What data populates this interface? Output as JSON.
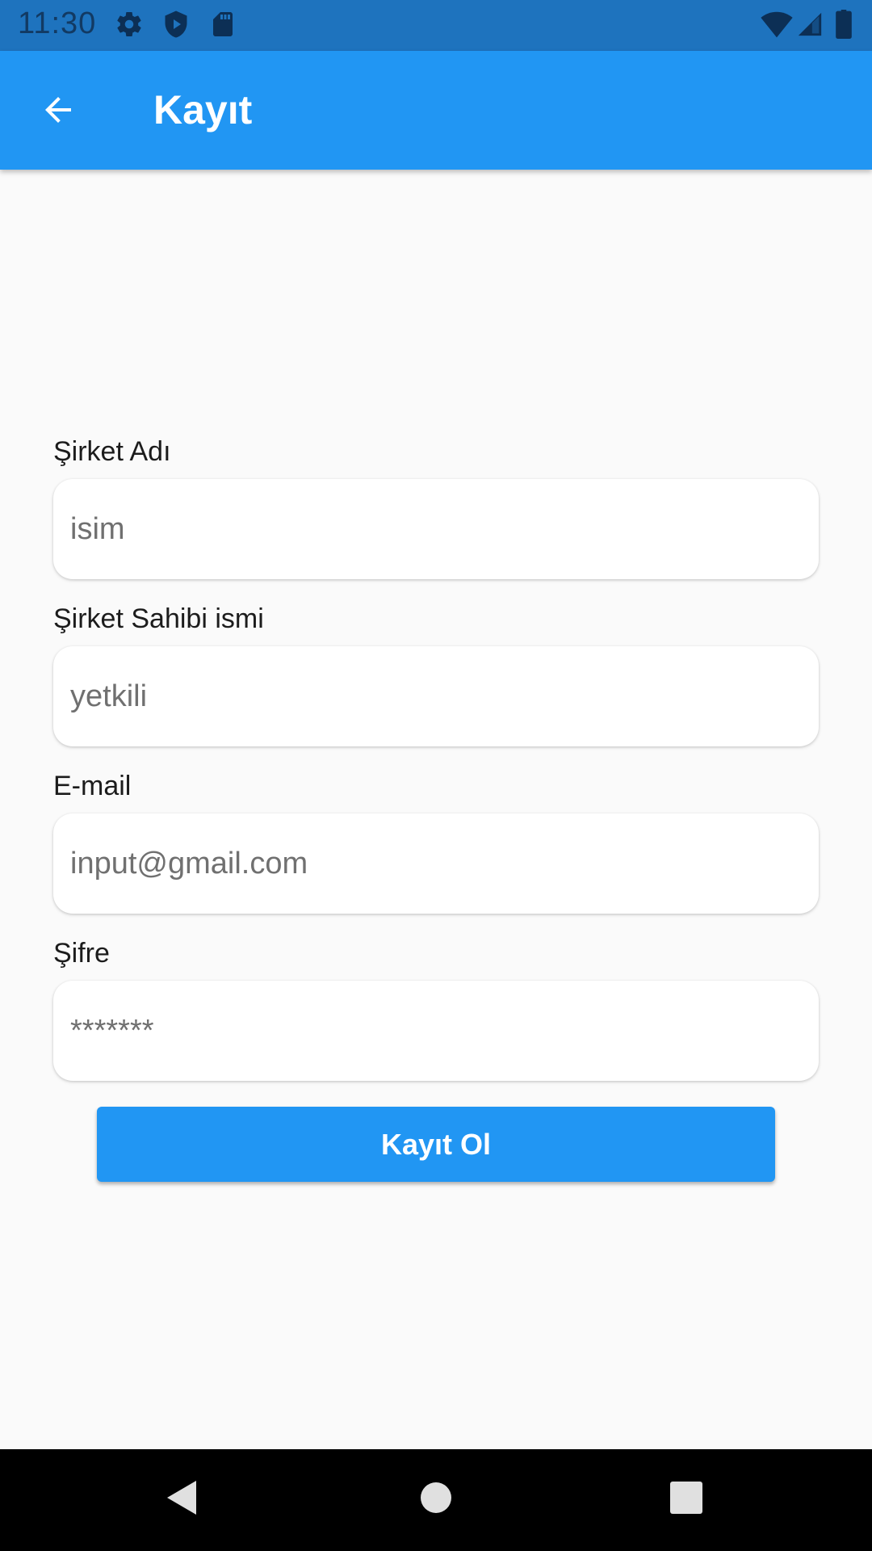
{
  "status_bar": {
    "time": "11:30",
    "icons_left": [
      "gear-icon",
      "shield-play-icon",
      "sd-card-icon"
    ],
    "icons_right": [
      "wifi-icon",
      "cellular-signal-icon",
      "battery-icon"
    ]
  },
  "app_bar": {
    "title": "Kayıt",
    "back_icon": "arrow-back-icon",
    "color": "#2196f3"
  },
  "form": {
    "company_name": {
      "label": "Şirket Adı",
      "placeholder": "isim"
    },
    "owner_name": {
      "label": "Şirket Sahibi ismi",
      "placeholder": "yetkili"
    },
    "email": {
      "label": "E-mail",
      "placeholder": "input@gmail.com"
    },
    "password": {
      "label": "Şifre",
      "placeholder": "*******"
    },
    "submit_label": "Kayıt Ol"
  },
  "nav_bar": {
    "icons": [
      "back-triangle-icon",
      "home-circle-icon",
      "recents-square-icon"
    ]
  }
}
